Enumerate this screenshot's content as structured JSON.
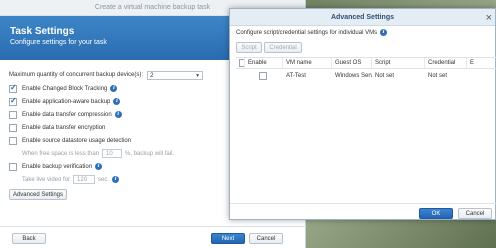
{
  "wizard": {
    "window_title": "Create a virtual machine backup task",
    "header_title": "Task Settings",
    "header_subtitle": "Configure settings for your task",
    "max_devices_label": "Maximum quantity of concurrent backup device(s):",
    "max_devices_value": "2",
    "options": [
      {
        "label": "Enable Changed Block Tracking",
        "checked": true,
        "info": true
      },
      {
        "label": "Enable application-aware backup",
        "checked": true,
        "info": true
      },
      {
        "label": "Enable data transfer compression",
        "checked": false,
        "info": true
      },
      {
        "label": "Enable data transfer encryption",
        "checked": false,
        "info": false
      },
      {
        "label": "Enable source datastore usage detection",
        "checked": false,
        "info": false
      }
    ],
    "free_space_prefix": "When free space is less than",
    "free_space_value": "10",
    "free_space_suffix": "%, backup will fail.",
    "verification_label": "Enable backup verification",
    "live_video_prefix": "Take live video for",
    "live_video_value": "120",
    "live_video_suffix": "sec.",
    "advanced_button": "Advanced Settings",
    "back_button": "Back",
    "next_button": "Next",
    "cancel_button": "Cancel"
  },
  "advanced": {
    "title": "Advanced Settings",
    "description": "Configure script/credential settings for individual VMs",
    "script_button": "Script",
    "credential_button": "Credential",
    "columns": [
      "Enable",
      "VM name",
      "Guest OS",
      "Script",
      "Credential",
      "E"
    ],
    "rows": [
      {
        "enabled": false,
        "vm_name": "AT-Test",
        "guest_os": "Windows Serve...",
        "script": "Not set",
        "credential": "Not set"
      }
    ],
    "ok_button": "OK",
    "cancel_button": "Cancel"
  }
}
